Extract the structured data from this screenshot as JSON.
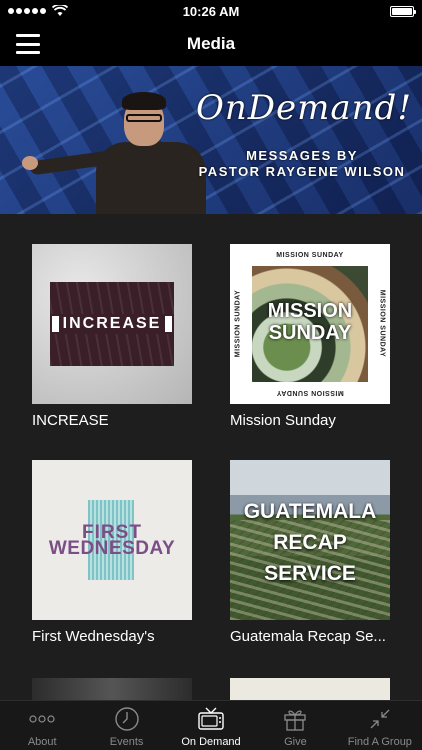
{
  "status_bar": {
    "time": "10:26 AM"
  },
  "nav": {
    "title": "Media"
  },
  "hero": {
    "title": "OnDemand!",
    "subtitle_line1": "MESSAGES BY",
    "subtitle_line2": "PASTOR RAYGENE WILSON"
  },
  "series": [
    {
      "title": "INCREASE",
      "art_text": "INCREASE"
    },
    {
      "title": "Mission Sunday",
      "art_text_line1": "MISSION",
      "art_text_line2": "SUNDAY",
      "art_edge": "MISSION SUNDAY"
    },
    {
      "title": "First Wednesday's",
      "art_text_line1": "FIRST",
      "art_text_line2": "WEDNESDAY"
    },
    {
      "title": "Guatemala Recap Se...",
      "art_text_line1": "GUATEMALA",
      "art_text_line2": "RECAP",
      "art_text_line3": "SERVICE"
    }
  ],
  "tabs": [
    {
      "label": "About",
      "icon": "more-dots-icon",
      "active": false
    },
    {
      "label": "Events",
      "icon": "clock-icon",
      "active": false
    },
    {
      "label": "On Demand",
      "icon": "tv-icon",
      "active": true
    },
    {
      "label": "Give",
      "icon": "gift-icon",
      "active": false
    },
    {
      "label": "Find A Group",
      "icon": "collapse-arrows-icon",
      "active": false
    }
  ],
  "colors": {
    "background": "#1e1e1e",
    "bar": "#000000",
    "tab_inactive": "#8a8a8a",
    "tab_active": "#ffffff"
  }
}
